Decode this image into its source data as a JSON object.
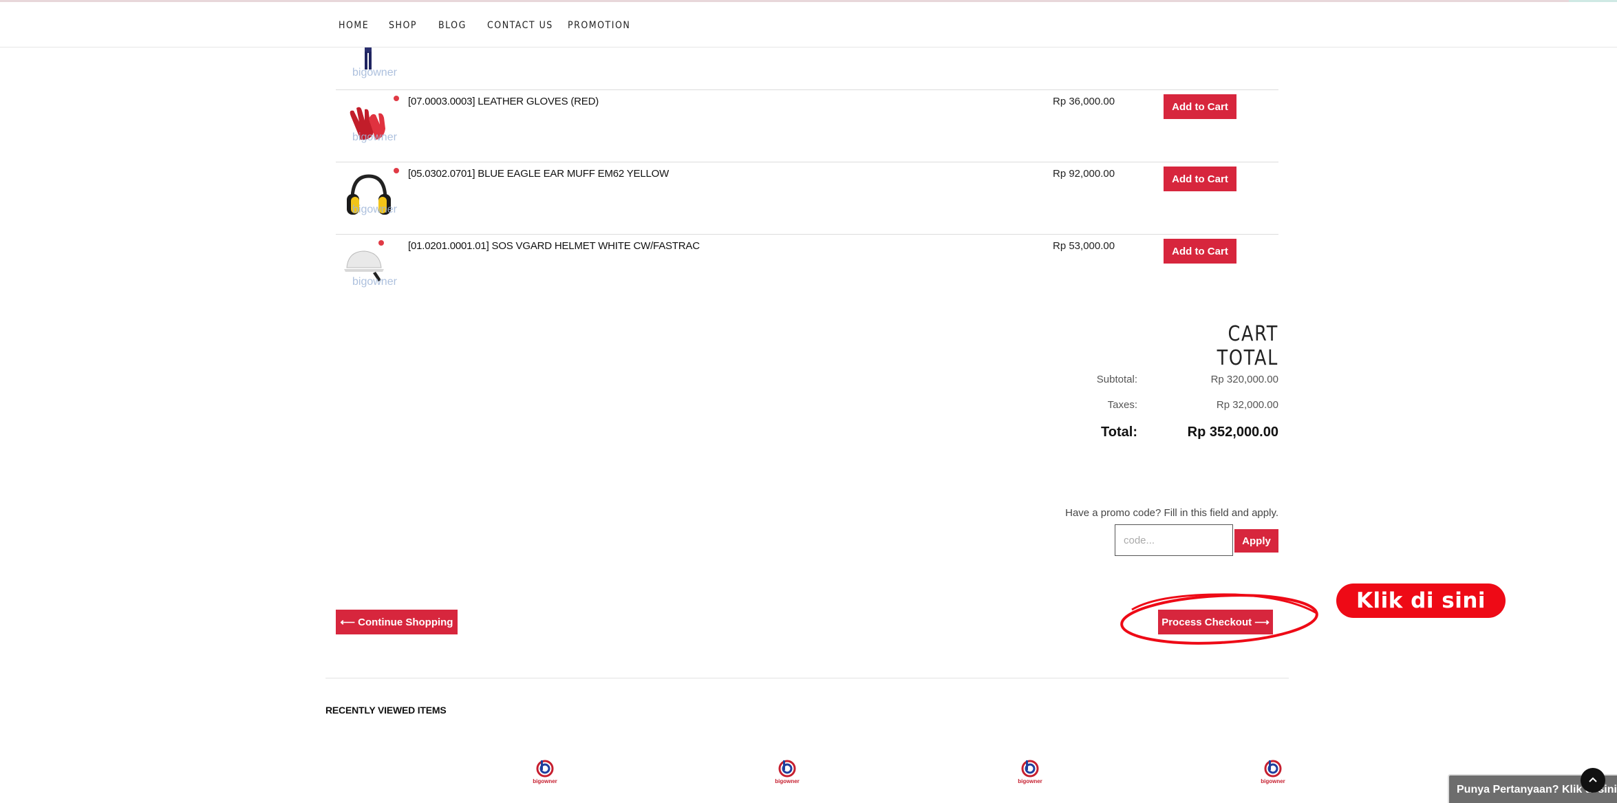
{
  "nav": {
    "items": [
      "HOME",
      "SHOP",
      "BLOG",
      "CONTACT US",
      "PROMOTION"
    ]
  },
  "partial_row": {
    "watermark": "bigowner"
  },
  "products": [
    {
      "name": "[07.0003.0003] LEATHER GLOVES (RED)",
      "price": "Rp 36,000.00",
      "button": "Add to Cart",
      "watermark": "bigowner",
      "icon": "red-gloves-image"
    },
    {
      "name": "[05.0302.0701] BLUE EAGLE EAR MUFF EM62 YELLOW",
      "price": "Rp 92,000.00",
      "button": "Add to Cart",
      "watermark": "bigowner",
      "icon": "ear-muff-image"
    },
    {
      "name": "[01.0201.0001.01] SOS VGARD HELMET WHITE CW/FASTRAC",
      "price": "Rp 53,000.00",
      "button": "Add to Cart",
      "watermark": "bigowner",
      "icon": "helmet-image"
    }
  ],
  "cart_total": {
    "title": "CART TOTAL",
    "subtotal_label": "Subtotal:",
    "subtotal_value": "Rp 320,000.00",
    "taxes_label": "Taxes:",
    "taxes_value": "Rp 32,000.00",
    "total_label": "Total:",
    "total_value": "Rp 352,000.00"
  },
  "promo": {
    "prompt": "Have a promo code? Fill in this field and apply.",
    "placeholder": "code...",
    "apply_label": "Apply"
  },
  "actions": {
    "continue_label": "⟵ Continue Shopping",
    "checkout_label": "Process Checkout ⟶",
    "annotation": "Klik di sini"
  },
  "recent": {
    "title": "RECENTLY VIEWED ITEMS",
    "logo_text": "bigowner"
  },
  "chat": {
    "label": "Punya Pertanyaan? Klik di sini"
  },
  "colors": {
    "brand_red": "#d7263d",
    "annotation_red": "#ee0a16"
  }
}
